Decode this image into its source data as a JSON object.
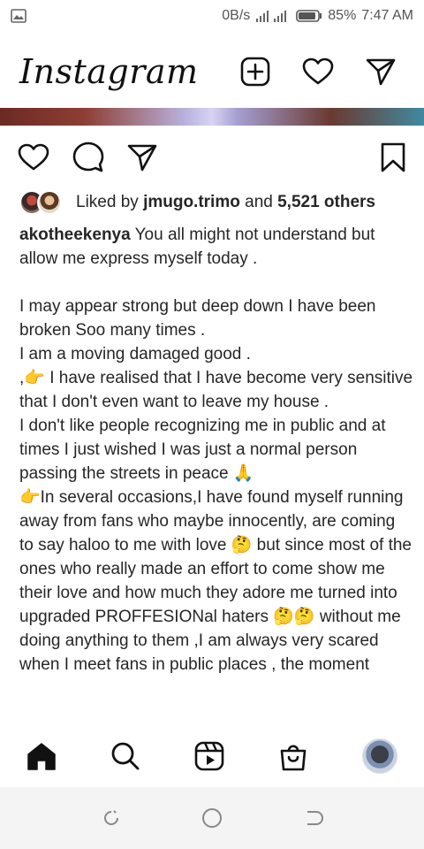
{
  "status_bar": {
    "network_speed": "0B/s",
    "battery": "85%",
    "time": "7:47 AM",
    "icons": [
      "gallery-icon",
      "signal-icon",
      "battery-icon"
    ]
  },
  "header": {
    "logo_text": "Instagram",
    "icons": [
      "new-post-icon",
      "heart-icon",
      "direct-message-icon"
    ]
  },
  "post": {
    "actions": [
      "like-icon",
      "comment-icon",
      "share-icon",
      "save-icon"
    ],
    "likes": {
      "prefix": "Liked by",
      "user": "jmugo.trimo",
      "connector": "and",
      "others": "5,521 others"
    },
    "caption": {
      "username": "akotheekenya",
      "first_line": "You all might not understand but allow me express myself today .",
      "paragraphs": [
        "I may appear strong but deep down I have been broken Soo many times .",
        "I am a moving damaged good .",
        ",👉 I have realised that I have become very sensitive that I don't even want to leave my house .",
        "I don't like people recognizing me in public and at times I just wished I was just a normal person passing the streets in peace 🙏",
        "👉In several occasions,I have found myself running away from fans who maybe innocently,  are coming to say haloo to me with love 🤔 but since most of  the ones who really made an effort to come show me their love and how much they adore me turned into upgraded PROFFESIONal haters 🤔🤔 without me doing anything to them ,I am always very scared when I meet fans in public places , the moment"
      ]
    }
  },
  "bottom_nav": {
    "items": [
      "home-icon",
      "search-icon",
      "reels-icon",
      "shop-icon",
      "profile-avatar"
    ]
  },
  "system_nav": {
    "items": [
      "recent-apps-icon",
      "home-circle-icon",
      "back-icon"
    ]
  }
}
